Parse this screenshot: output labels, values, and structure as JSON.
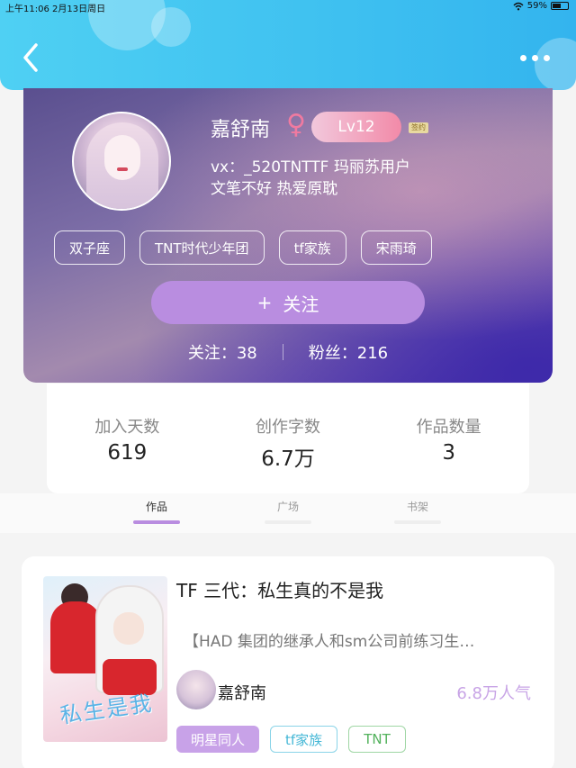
{
  "status_bar": {
    "time": "上午11:06",
    "date": "2月13日周日",
    "battery": "59%",
    "battery_level": 0.59
  },
  "header": {
    "back_icon": "chevron-left-icon",
    "more_icon": "more-dots-icon"
  },
  "profile": {
    "name": "嘉舒南",
    "gender_symbol": "♀",
    "level": "Lv12",
    "sign_badge": "签约",
    "bio_line1": "vx：_520TNTTF 玛丽苏用户",
    "bio_line2": "文笔不好 热爱原耽",
    "tags": [
      "双子座",
      "TNT时代少年团",
      "tf家族",
      "宋雨琦"
    ],
    "follow_button": {
      "icon": "+",
      "label": "关注"
    },
    "following": "关注：38",
    "followers": "粉丝：216"
  },
  "stats": [
    {
      "label": "加入天数",
      "value": "619"
    },
    {
      "label": "创作字数",
      "value": "6.7万"
    },
    {
      "label": "作品数量",
      "value": "3"
    }
  ],
  "tabs": [
    {
      "label": "作品",
      "active": true
    },
    {
      "label": "广场",
      "active": false
    },
    {
      "label": "书架",
      "active": false
    }
  ],
  "work": {
    "title": "TF 三代：私生真的不是我",
    "summary": "【HAD 集团的继承人和sm公司前练习生…",
    "cover_text": "私生是我",
    "author": "嘉舒南",
    "popularity": "6.8万人气",
    "tags": [
      "明星同人",
      "tf家族",
      "TNT"
    ]
  },
  "colors": {
    "header": "#3ec0f0",
    "accent_purple": "#b98de0",
    "tag_purple": "#c8a2e8"
  }
}
